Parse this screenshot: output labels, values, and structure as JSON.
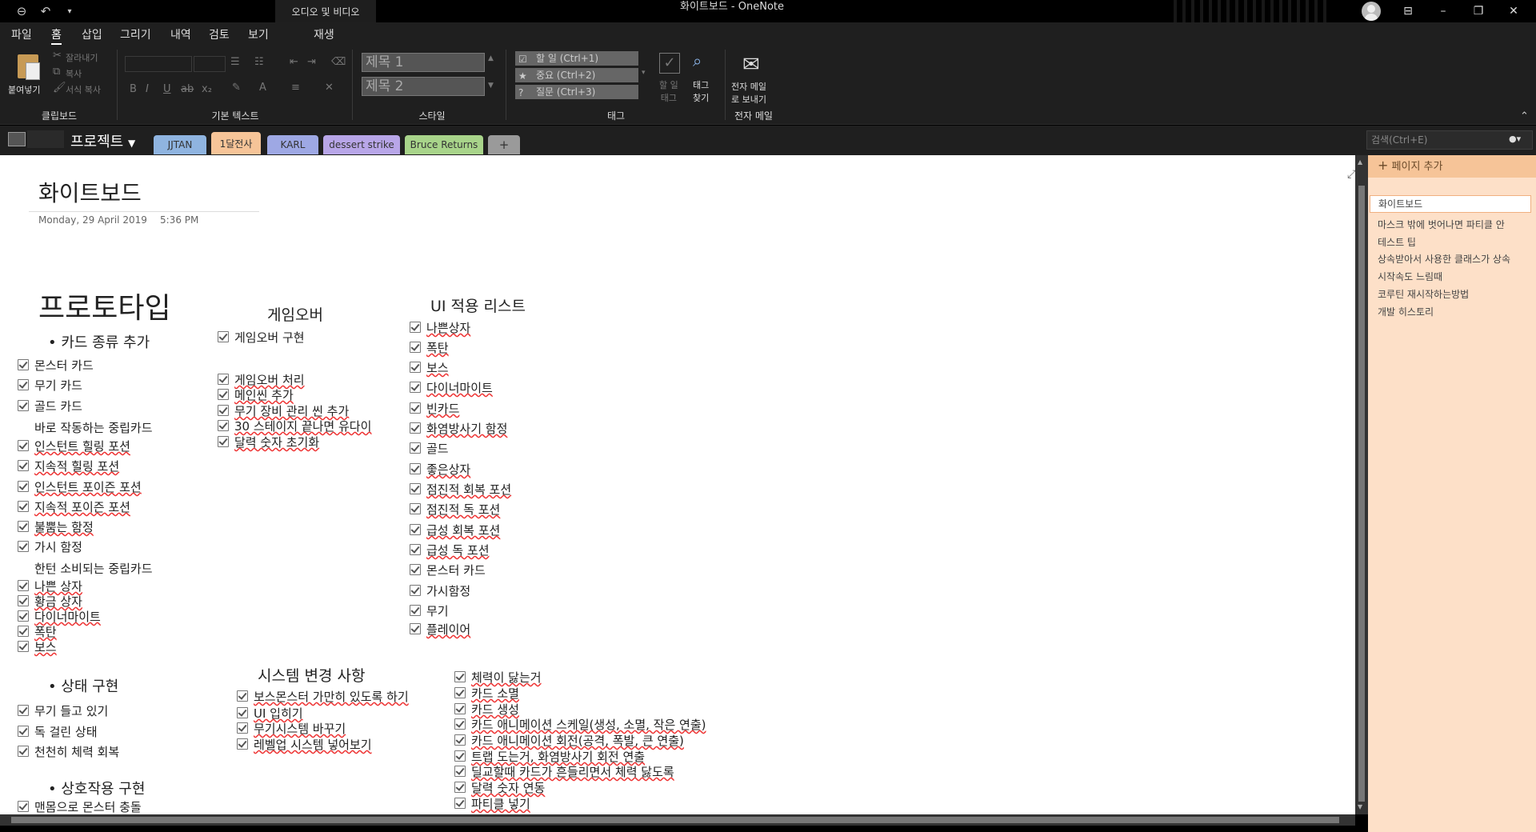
{
  "titlebar": {
    "context_tab": "오디오 및 비디오",
    "title": "화이트보드  -  OneNote"
  },
  "menu": [
    "파일",
    "홈",
    "삽입",
    "그리기",
    "내역",
    "검토",
    "보기",
    "재생"
  ],
  "ribbon": {
    "clipboard": {
      "paste": "붙여넣기",
      "cut": "잘라내기",
      "copy": "복사",
      "format_painter": "서식 복사",
      "label": "클립보드"
    },
    "basic_text": {
      "label": "기본 텍스트"
    },
    "styles": {
      "h1": "제목 1",
      "h2": "제목 2",
      "label": "스타일"
    },
    "tags": {
      "todo": "할 일 (Ctrl+1)",
      "important": "중요 (Ctrl+2)",
      "question": "질문 (Ctrl+3)",
      "todo_tag": "할 일\n태그",
      "find_tags": "태그\n찾기",
      "label": "태그"
    },
    "email": {
      "send": "전자 메일\n로 보내기",
      "label": "전자 메일"
    }
  },
  "notebook": {
    "name": "프로젝트",
    "sections": [
      "JJTAN",
      "1달전사",
      "KARL",
      "dessert strike",
      "Bruce Returns",
      "+"
    ],
    "search_placeholder": "검색(Ctrl+E)"
  },
  "page": {
    "title": "화이트보드",
    "date": "Monday, 29 April 2019",
    "time": "5:36 PM"
  },
  "content": {
    "prototype": "프로토타입",
    "card_types": {
      "heading": "카드 종류 추가",
      "items": [
        "몬스터 카드",
        "무기 카드",
        "골드 카드",
        "바로 작동하는 중립카드",
        "인스턴트 힐링 포션",
        "지속적 힐링 포션",
        "인스턴트 포이즌 포션",
        "지속적 포이즌 포션",
        "불뿜는 함정",
        "가시 함정",
        "한턴 소비되는 중립카드",
        "나쁜 상자",
        "황금 상자",
        "다이너마이트",
        "폭탄",
        "보스"
      ]
    },
    "state": {
      "heading": "상태 구현",
      "items": [
        "무기 들고 있기",
        "독 걸린 상태",
        "천천히 체력 회복"
      ]
    },
    "interaction": {
      "heading": "상호작용 구현",
      "items": [
        "맨몸으로 몬스터 충돌"
      ]
    },
    "gameover": {
      "heading": "게임오버",
      "items": [
        "게임오버 구현",
        "게임오버 처리",
        "메인씬 추가",
        "무기 장비 관리 씬 추가",
        "30 스테이지 끝나면 유다이",
        "달력 숫자 초기화"
      ]
    },
    "ui_list": {
      "heading": "UI 적용 리스트",
      "items": [
        "나쁜상자",
        "폭탄",
        "보스",
        "다이너마이트",
        "빈카드",
        "화염방사기 함정",
        "골드",
        "좋은상자",
        "점진적 회복 포션",
        "점진적 독 포션",
        "급성 회복 포션",
        "급성 독 포션",
        "몬스터 카드",
        "가시함정",
        "무기",
        "플레이어"
      ]
    },
    "system": {
      "heading": "시스템 변경 사항",
      "items": [
        "보스몬스터 가만히 있도록 하기",
        "UI 입히기",
        "무기시스템 바꾸기",
        "레벨업 시스템 넣어보기"
      ]
    },
    "anim": {
      "items": [
        "체력이 닳는거",
        "카드 소멸",
        "카드 생성",
        "카드 애니메이션 스케일(생성, 소멸, 작은 연출)",
        "카드 애니메이션 회전(공격, 폭발, 큰 연출)",
        "트랩 도는거, 화염방사기 회전 연출",
        "딜교할때 카드가 흔들리면서 체력 닳도록",
        "달력 숫자 연동",
        "파티클 넣기"
      ]
    }
  },
  "pages": {
    "add": "페이지 추가",
    "items": [
      "화이트보드",
      "마스크 밖에 벗어나면 파티클 안",
      "테스트 팁",
      "상속받아서 사용한 클래스가 상속",
      "시작속도 느림때",
      "코루틴 재시작하는방법",
      "개발 히스토리"
    ]
  },
  "colors": {
    "accent": "#f6c498",
    "panel": "#fde0c8",
    "tab_jjtan": "#8fb4e0",
    "tab_1dal": "#f6c498",
    "tab_karl": "#9ea8e4",
    "tab_dessert": "#b8a6e8",
    "tab_bruce": "#a8d48a"
  }
}
